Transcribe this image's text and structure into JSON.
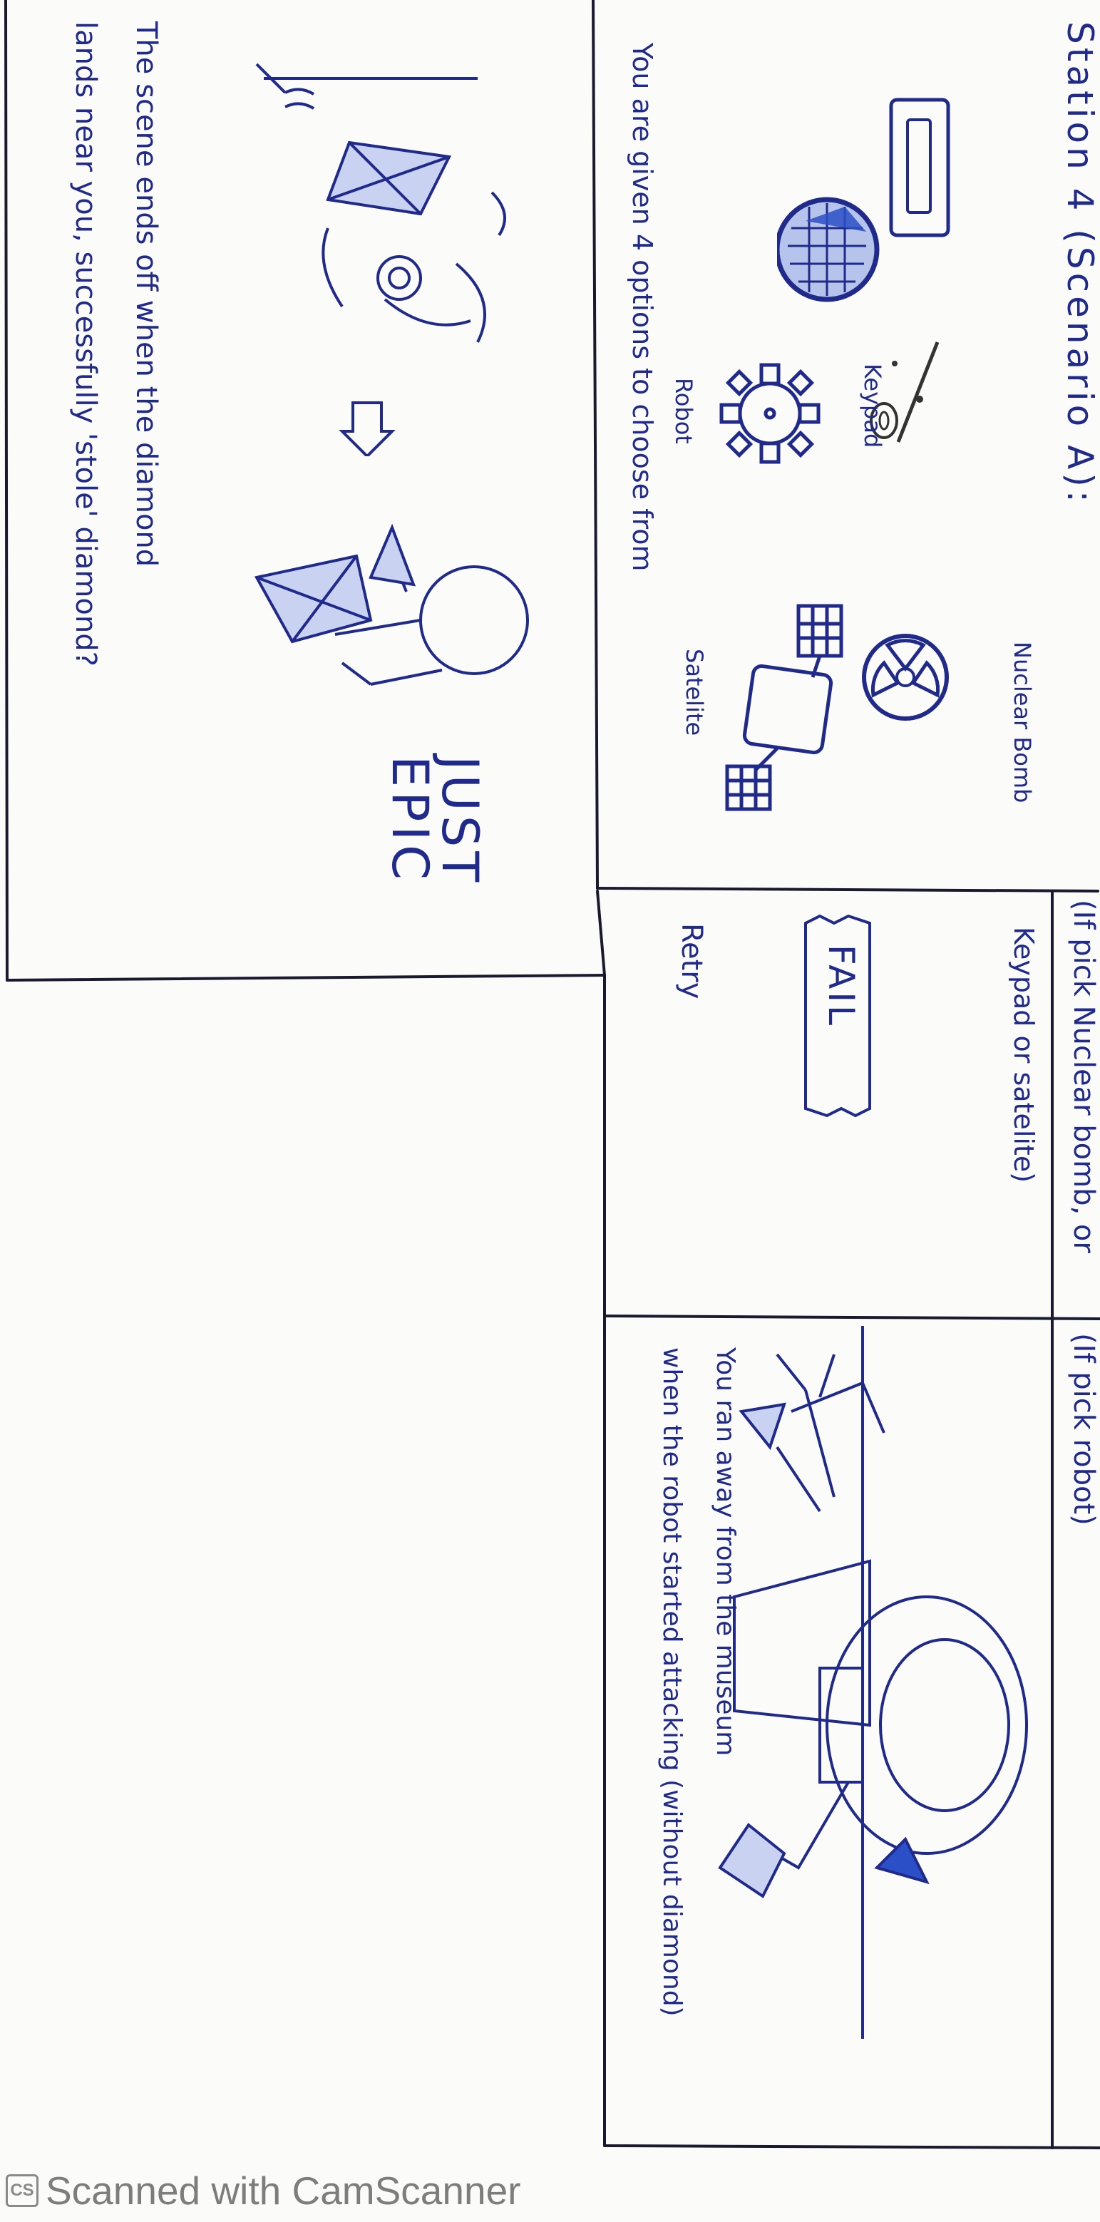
{
  "station_panel": {
    "title": "Station 4 (Scenario A):",
    "options": {
      "keypad": "Keypad",
      "robot": "Robot",
      "nuclear_bomb": "Nuclear Bomb",
      "satelite": "Satelite"
    },
    "instruction": "You are given 4 options to choose from"
  },
  "ending_panel": {
    "epic": "JUST EPIC",
    "caption_line1": "The scene ends off when the diamond",
    "caption_line2": "lands near you, successfully 'stole' diamond?"
  },
  "fail_panel": {
    "condition_line1": "(If pick Nuclear bomb, or",
    "condition_line2": "Keypad or satelite)",
    "fail_label": "FAIL",
    "retry": "Retry"
  },
  "robot_panel": {
    "condition": "(If pick robot)",
    "caption_line1": "You ran away from the museum",
    "caption_line2": "when the robot started attacking (without diamond)"
  },
  "footer": {
    "badge": "CS",
    "watermark": "Scanned with CamScanner"
  },
  "colors": {
    "ink": "#1f2a8a",
    "frame": "#1a1a2e",
    "paper": "#fbfbfa",
    "watermark": "#7d7d7d"
  }
}
